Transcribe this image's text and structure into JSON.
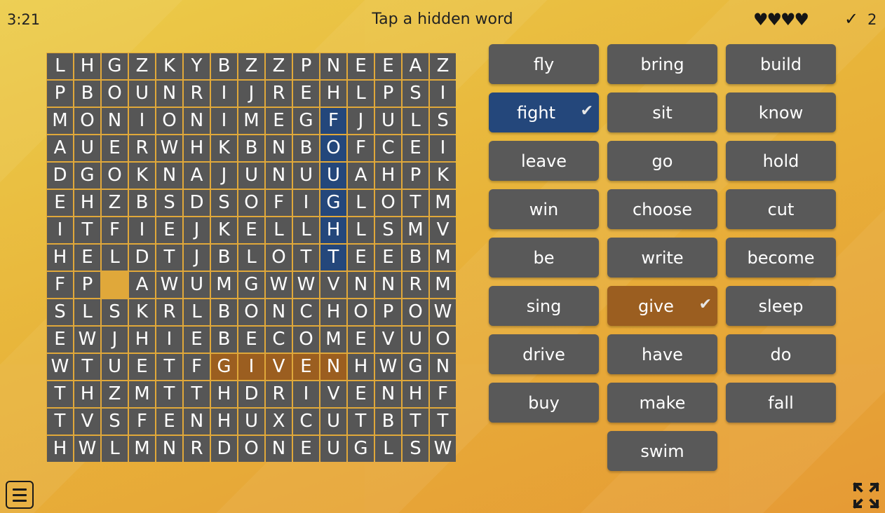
{
  "header": {
    "timer": "3:21",
    "title": "Tap a hidden word",
    "lives": "♥♥♥♥",
    "check_icon": "✓",
    "score": "2"
  },
  "grid": {
    "rows": [
      "LHGZKYBZZPNEEAZ",
      "PBOUNRIJREHLPSI",
      "MONIONIMEGFJULS",
      "AUERWHKBNBOFCEI",
      "DGOKNAJUNUUAHPK",
      "EHZBSDSOFIGLOTM",
      "ITFIEJKELLHLSMV",
      "HELDTJBLOTTEEBM",
      "FP AWUMGWWVNNRM",
      "SLSKRLBONCHOPOW",
      "EWJHIEBECOMEVUO",
      "WTUETFGIVENHWGN",
      "THZMTTHDRIVENHF",
      "TVSFENHUXCUTBTT",
      "HWLMNRDONEUGLSW"
    ],
    "highlight_blue": [
      [
        2,
        10
      ],
      [
        3,
        10
      ],
      [
        4,
        10
      ],
      [
        5,
        10
      ],
      [
        6,
        10
      ],
      [
        7,
        10
      ]
    ],
    "highlight_orange": [
      [
        11,
        6
      ],
      [
        11,
        7
      ],
      [
        11,
        8
      ],
      [
        11,
        9
      ],
      [
        11,
        10
      ]
    ],
    "colors": {
      "cell": "#565656",
      "blue": "#24477b",
      "orange": "#9b5e20"
    }
  },
  "words": [
    {
      "label": "fly",
      "state": ""
    },
    {
      "label": "bring",
      "state": ""
    },
    {
      "label": "build",
      "state": ""
    },
    {
      "label": "fight",
      "state": "found-blue"
    },
    {
      "label": "sit",
      "state": ""
    },
    {
      "label": "know",
      "state": ""
    },
    {
      "label": "leave",
      "state": ""
    },
    {
      "label": "go",
      "state": ""
    },
    {
      "label": "hold",
      "state": ""
    },
    {
      "label": "win",
      "state": ""
    },
    {
      "label": "choose",
      "state": ""
    },
    {
      "label": "cut",
      "state": ""
    },
    {
      "label": "be",
      "state": ""
    },
    {
      "label": "write",
      "state": ""
    },
    {
      "label": "become",
      "state": ""
    },
    {
      "label": "sing",
      "state": ""
    },
    {
      "label": "give",
      "state": "found-orange"
    },
    {
      "label": "sleep",
      "state": ""
    },
    {
      "label": "drive",
      "state": ""
    },
    {
      "label": "have",
      "state": ""
    },
    {
      "label": "do",
      "state": ""
    },
    {
      "label": "buy",
      "state": ""
    },
    {
      "label": "make",
      "state": ""
    },
    {
      "label": "fall",
      "state": ""
    },
    {
      "label": "swim",
      "state": ""
    }
  ],
  "found_check_icon": "✔"
}
